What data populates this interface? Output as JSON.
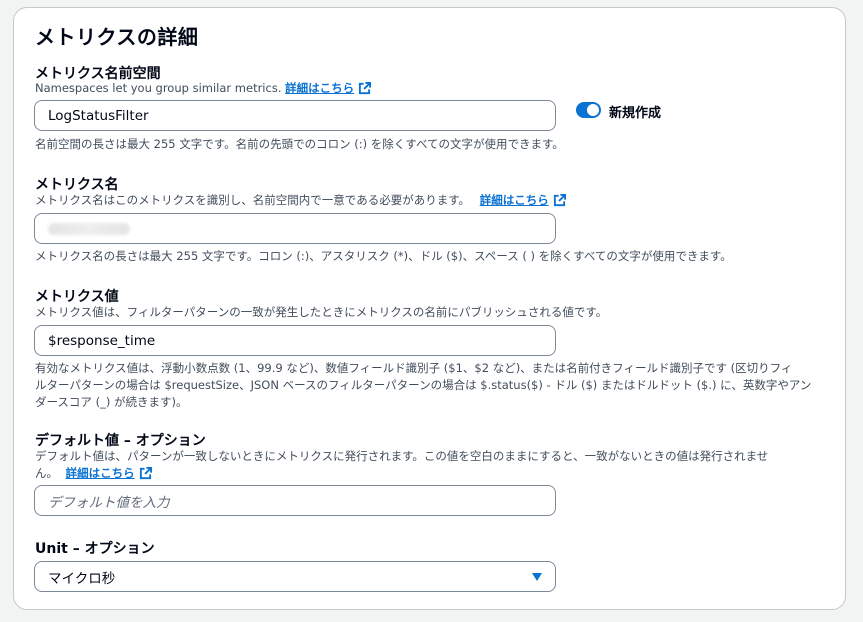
{
  "panel": {
    "title": "メトリクスの詳細"
  },
  "namespace": {
    "label": "メトリクス名前空間",
    "description": "Namespaces let you group similar metrics.",
    "link": "詳細はこちら",
    "value": "LogStatusFilter",
    "toggle_label": "新規作成",
    "toggle_on": true,
    "hint": "名前空間の長さは最大 255 文字です。名前の先頭でのコロン (:) を除くすべての文字が使用できます。"
  },
  "metric_name": {
    "label": "メトリクス名",
    "description": "メトリクス名はこのメトリクスを識別し、名前空間内で一意である必要があります。",
    "link": "詳細はこちら",
    "hint": "メトリクス名の長さは最大 255 文字です。コロン (:)、アスタリスク (*)、ドル ($)、スペース ( ) を除くすべての文字が使用できます。"
  },
  "metric_value": {
    "label": "メトリクス値",
    "description": "メトリクス値は、フィルターパターンの一致が発生したときにメトリクスの名前にパブリッシュされる値です。",
    "value": "$response_time",
    "hint_lines": [
      "有効なメトリクス値は、浮動小数点数 (1、99.9 など)、数値フィールド識別子 ($1、$2 など)、または名前付きフィールド識別子です (区切りフィ",
      "ルターパターンの場合は $requestSize、JSON ベースのフィルターパターンの場合は $.status($) - ドル ($) またはドルドット ($.) に、英数字やアン",
      "ダースコア (_) が続きます)。"
    ]
  },
  "default_value": {
    "label": "デフォルト値 – オプション",
    "description_line1": "デフォルト値は、パターンが一致しないときにメトリクスに発行されます。この値を空白のままにすると、一致がないときの値は発行されませ",
    "description_line2": "ん。",
    "link": "詳細はこちら",
    "placeholder": "デフォルト値を入力"
  },
  "unit": {
    "label": "Unit – オプション",
    "selected": "マイクロ秒"
  },
  "colors": {
    "link": "#0972d3",
    "border": "#7d8998",
    "text_secondary": "#414d5c"
  }
}
